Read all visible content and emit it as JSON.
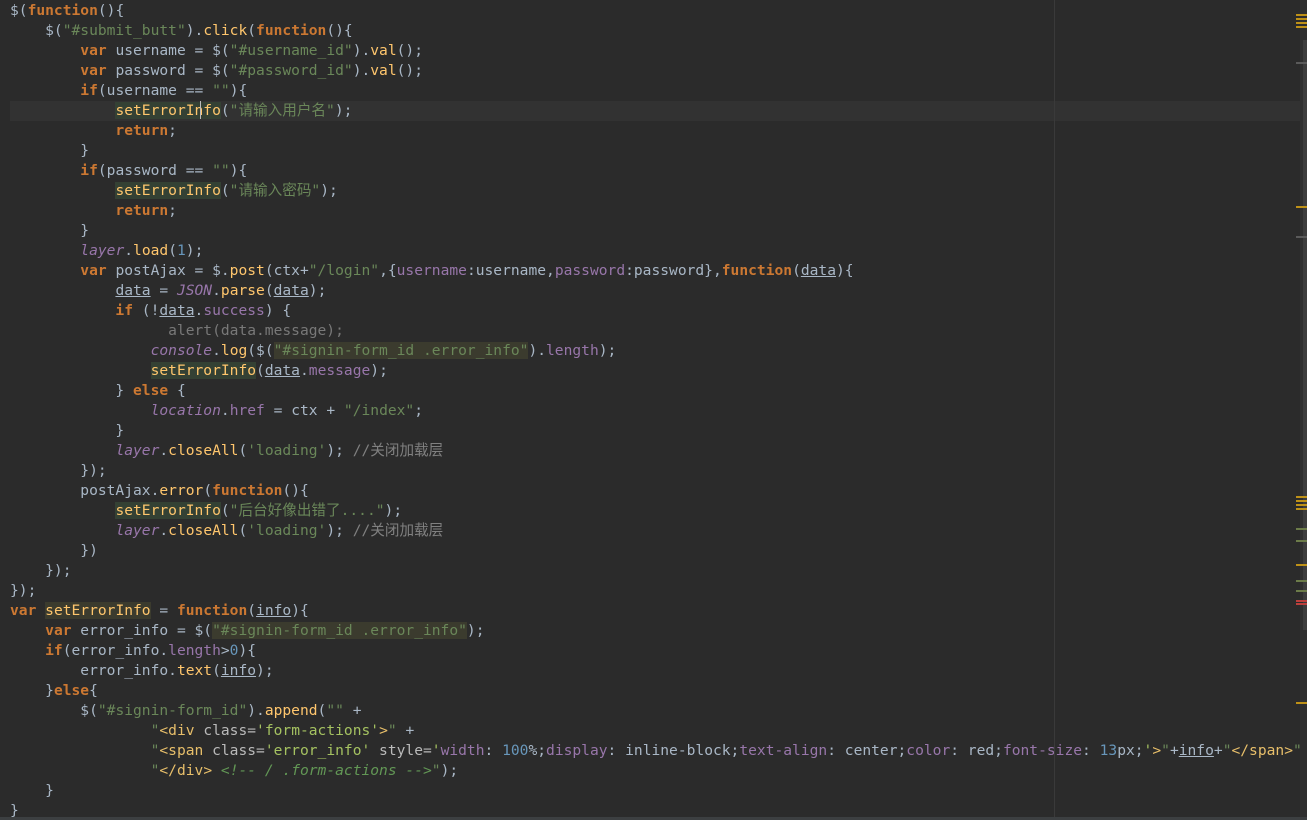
{
  "editor": {
    "language": "javascript",
    "caret_line": 6,
    "lines": [
      [
        [
          "t-default",
          "$("
        ],
        [
          "t-kw",
          "function"
        ],
        [
          "t-default",
          "(){"
        ]
      ],
      [
        [
          "t-default",
          "    $("
        ],
        [
          "t-str",
          "\"#submit_butt\""
        ],
        [
          "t-default",
          ")."
        ],
        [
          "t-fn",
          "click"
        ],
        [
          "t-default",
          "("
        ],
        [
          "t-kw",
          "function"
        ],
        [
          "t-default",
          "(){"
        ]
      ],
      [
        [
          "t-default",
          "        "
        ],
        [
          "t-kw",
          "var"
        ],
        [
          "t-default",
          " username = $("
        ],
        [
          "t-str",
          "\"#username_id\""
        ],
        [
          "t-default",
          ")."
        ],
        [
          "t-fn",
          "val"
        ],
        [
          "t-default",
          "();"
        ]
      ],
      [
        [
          "t-default",
          "        "
        ],
        [
          "t-kw",
          "var"
        ],
        [
          "t-default",
          " password = $("
        ],
        [
          "t-str",
          "\"#password_id\""
        ],
        [
          "t-default",
          ")."
        ],
        [
          "t-fn",
          "val"
        ],
        [
          "t-default",
          "();"
        ]
      ],
      [
        [
          "t-kw",
          "        if"
        ],
        [
          "t-default",
          "(username == "
        ],
        [
          "t-str",
          "\"\""
        ],
        [
          "t-default",
          "){"
        ]
      ],
      [
        [
          "t-default",
          "            "
        ],
        [
          "t-fnhl",
          "setErrorInfo"
        ],
        [
          "t-default",
          "("
        ],
        [
          "t-str",
          "\"请输入用户名\""
        ],
        [
          "t-default",
          ");"
        ]
      ],
      [
        [
          "t-kw",
          "            return"
        ],
        [
          "t-default",
          ";"
        ]
      ],
      [
        [
          "t-default",
          "        }"
        ]
      ],
      [
        [
          "t-kw",
          "        if"
        ],
        [
          "t-default",
          "(password == "
        ],
        [
          "t-str",
          "\"\""
        ],
        [
          "t-default",
          "){"
        ]
      ],
      [
        [
          "t-default",
          "            "
        ],
        [
          "t-fnhl",
          "setErrorInfo"
        ],
        [
          "t-default",
          "("
        ],
        [
          "t-str",
          "\"请输入密码\""
        ],
        [
          "t-default",
          ");"
        ]
      ],
      [
        [
          "t-kw",
          "            return"
        ],
        [
          "t-default",
          ";"
        ]
      ],
      [
        [
          "t-default",
          "        }"
        ]
      ],
      [
        [
          "t-default",
          "        "
        ],
        [
          "t-global",
          "layer"
        ],
        [
          "t-default",
          "."
        ],
        [
          "t-fn",
          "load"
        ],
        [
          "t-default",
          "("
        ],
        [
          "t-num",
          "1"
        ],
        [
          "t-default",
          ");"
        ]
      ],
      [
        [
          "t-default",
          "        "
        ],
        [
          "t-kw",
          "var"
        ],
        [
          "t-default",
          " postAjax = $."
        ],
        [
          "t-fn",
          "post"
        ],
        [
          "t-default",
          "(ctx+"
        ],
        [
          "t-str",
          "\"/login\""
        ],
        [
          "t-default",
          ",{"
        ],
        [
          "t-prop",
          "username"
        ],
        [
          "t-default",
          ":username,"
        ],
        [
          "t-prop",
          "password"
        ],
        [
          "t-default",
          ":password},"
        ],
        [
          "t-kw",
          "function"
        ],
        [
          "t-default",
          "("
        ],
        [
          "t-ref",
          "data"
        ],
        [
          "t-default",
          "){"
        ]
      ],
      [
        [
          "t-default",
          "            "
        ],
        [
          "t-ref",
          "data"
        ],
        [
          "t-default",
          " = "
        ],
        [
          "t-global",
          "JSON"
        ],
        [
          "t-default",
          "."
        ],
        [
          "t-fn",
          "parse"
        ],
        [
          "t-default",
          "("
        ],
        [
          "t-ref",
          "data"
        ],
        [
          "t-default",
          ");"
        ]
      ],
      [
        [
          "t-kw",
          "            if"
        ],
        [
          "t-default",
          " (!"
        ],
        [
          "t-ref",
          "data"
        ],
        [
          "t-default",
          "."
        ],
        [
          "t-prop",
          "success"
        ],
        [
          "t-default",
          ") {"
        ]
      ],
      [
        [
          "t-dim",
          "                  alert(data.message);"
        ]
      ],
      [
        [
          "t-default",
          "                "
        ],
        [
          "t-global",
          "console"
        ],
        [
          "t-default",
          "."
        ],
        [
          "t-fn",
          "log"
        ],
        [
          "t-default",
          "($("
        ],
        [
          "t-strhl",
          "\"#signin-form_id .error_info\""
        ],
        [
          "t-default",
          ")."
        ],
        [
          "t-prop",
          "length"
        ],
        [
          "t-default",
          ");"
        ]
      ],
      [
        [
          "t-default",
          "                "
        ],
        [
          "t-fnhl",
          "setErrorInfo"
        ],
        [
          "t-default",
          "("
        ],
        [
          "t-ref",
          "data"
        ],
        [
          "t-default",
          "."
        ],
        [
          "t-prop",
          "message"
        ],
        [
          "t-default",
          ");"
        ]
      ],
      [
        [
          "t-default",
          "            } "
        ],
        [
          "t-kw",
          "else"
        ],
        [
          "t-default",
          " {"
        ]
      ],
      [
        [
          "t-default",
          "                "
        ],
        [
          "t-global",
          "location"
        ],
        [
          "t-default",
          "."
        ],
        [
          "t-prop",
          "href"
        ],
        [
          "t-default",
          " = ctx + "
        ],
        [
          "t-str",
          "\"/index\""
        ],
        [
          "t-default",
          ";"
        ]
      ],
      [
        [
          "t-default",
          "            }"
        ]
      ],
      [
        [
          "t-default",
          "            "
        ],
        [
          "t-global",
          "layer"
        ],
        [
          "t-default",
          "."
        ],
        [
          "t-fn",
          "closeAll"
        ],
        [
          "t-default",
          "("
        ],
        [
          "t-str",
          "'loading'"
        ],
        [
          "t-default",
          "); "
        ],
        [
          "t-comment",
          "//关闭加载层"
        ]
      ],
      [
        [
          "t-default",
          "        });"
        ]
      ],
      [
        [
          "t-default",
          "        postAjax."
        ],
        [
          "t-fn",
          "error"
        ],
        [
          "t-default",
          "("
        ],
        [
          "t-kw",
          "function"
        ],
        [
          "t-default",
          "(){"
        ]
      ],
      [
        [
          "t-default",
          "            "
        ],
        [
          "t-fnhl",
          "setErrorInfo"
        ],
        [
          "t-default",
          "("
        ],
        [
          "t-str",
          "\"后台好像出错了....\""
        ],
        [
          "t-default",
          ");"
        ]
      ],
      [
        [
          "t-default",
          "            "
        ],
        [
          "t-global",
          "layer"
        ],
        [
          "t-default",
          "."
        ],
        [
          "t-fn",
          "closeAll"
        ],
        [
          "t-default",
          "("
        ],
        [
          "t-str",
          "'loading'"
        ],
        [
          "t-default",
          "); "
        ],
        [
          "t-comment",
          "//关闭加载层"
        ]
      ],
      [
        [
          "t-default",
          "        })"
        ]
      ],
      [
        [
          "t-default",
          "    });"
        ]
      ],
      [
        [
          "t-default",
          "});"
        ]
      ],
      [
        [
          "t-kw",
          "var"
        ],
        [
          "t-default",
          " "
        ],
        [
          "t-varhl",
          "setErrorInfo"
        ],
        [
          "t-default",
          " = "
        ],
        [
          "t-kw",
          "function"
        ],
        [
          "t-default",
          "("
        ],
        [
          "t-ref",
          "info"
        ],
        [
          "t-default",
          "){"
        ]
      ],
      [
        [
          "t-default",
          "    "
        ],
        [
          "t-kw",
          "var"
        ],
        [
          "t-default",
          " error_info = $("
        ],
        [
          "t-strhl",
          "\"#signin-form_id .error_info\""
        ],
        [
          "t-default",
          ");"
        ]
      ],
      [
        [
          "t-kw",
          "    if"
        ],
        [
          "t-default",
          "(error_info."
        ],
        [
          "t-prop",
          "length"
        ],
        [
          "t-default",
          ">"
        ],
        [
          "t-num",
          "0"
        ],
        [
          "t-default",
          "){"
        ]
      ],
      [
        [
          "t-default",
          "        error_info."
        ],
        [
          "t-fn",
          "text"
        ],
        [
          "t-default",
          "("
        ],
        [
          "t-ref",
          "info"
        ],
        [
          "t-default",
          ");"
        ]
      ],
      [
        [
          "t-default",
          "    }"
        ],
        [
          "t-kw",
          "else"
        ],
        [
          "t-default",
          "{"
        ]
      ],
      [
        [
          "t-default",
          "        $("
        ],
        [
          "t-str",
          "\"#signin-form_id\""
        ],
        [
          "t-default",
          ")."
        ],
        [
          "t-fn",
          "append"
        ],
        [
          "t-default",
          "("
        ],
        [
          "t-str",
          "\"\""
        ],
        [
          "t-default",
          " +"
        ]
      ],
      [
        [
          "t-default",
          "                "
        ],
        [
          "t-str",
          "\""
        ],
        [
          "t-tag",
          "<div "
        ],
        [
          "t-attr",
          "class="
        ],
        [
          "t-attrval",
          "'form-actions'"
        ],
        [
          "t-tag",
          ">"
        ],
        [
          "t-str",
          "\""
        ],
        [
          "t-default",
          " +"
        ]
      ],
      [
        [
          "t-default",
          "                "
        ],
        [
          "t-str",
          "\""
        ],
        [
          "t-tag",
          "<span "
        ],
        [
          "t-attr",
          "class="
        ],
        [
          "t-attrval",
          "'error_info'"
        ],
        [
          "t-attr",
          " style="
        ],
        [
          "t-attrval",
          "'"
        ],
        [
          "t-prop",
          "width"
        ],
        [
          "t-default",
          ": "
        ],
        [
          "t-num",
          "100"
        ],
        [
          "t-default",
          "%;"
        ],
        [
          "t-prop",
          "display"
        ],
        [
          "t-default",
          ": inline-block;"
        ],
        [
          "t-prop",
          "text-align"
        ],
        [
          "t-default",
          ": center;"
        ],
        [
          "t-prop",
          "color"
        ],
        [
          "t-default",
          ": red;"
        ],
        [
          "t-prop",
          "font-size"
        ],
        [
          "t-default",
          ": "
        ],
        [
          "t-num",
          "13"
        ],
        [
          "t-default",
          "px;"
        ],
        [
          "t-attrval",
          "'"
        ],
        [
          "t-tag",
          ">"
        ],
        [
          "t-str",
          "\""
        ],
        [
          "t-default",
          "+"
        ],
        [
          "t-ref",
          "info"
        ],
        [
          "t-default",
          "+"
        ],
        [
          "t-str",
          "\""
        ],
        [
          "t-tag",
          "</span>"
        ],
        [
          "t-str",
          "\""
        ]
      ],
      [
        [
          "t-default",
          "                "
        ],
        [
          "t-str",
          "\""
        ],
        [
          "t-tag",
          "</div>"
        ],
        [
          "t-default",
          " "
        ],
        [
          "t-doccomment",
          "<!-- / .form-actions -->"
        ],
        [
          "t-str",
          "\""
        ],
        [
          "t-default",
          ");"
        ]
      ],
      [
        [
          "t-default",
          "    }"
        ]
      ],
      [
        [
          "t-default",
          "}"
        ]
      ]
    ]
  },
  "markers": {
    "colors": {
      "warn": "#be9117",
      "info": "#6c7b49",
      "err": "#bc3f3c"
    }
  }
}
